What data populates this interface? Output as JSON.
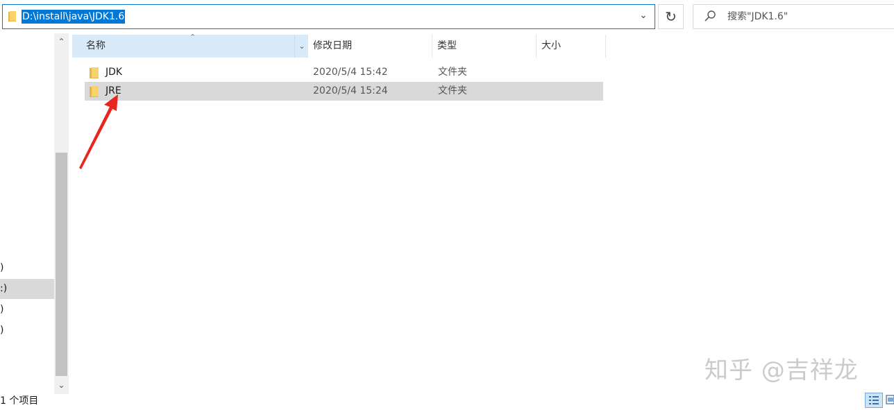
{
  "address_bar": {
    "path": "D:\\install\\java\\JDK1.6",
    "dropdown_icon": "chevron-down-icon",
    "refresh_icon": "refresh-icon"
  },
  "search": {
    "placeholder": "搜索\"JDK1.6\"",
    "icon": "search-icon"
  },
  "columns": {
    "name": "名称",
    "date_modified": "修改日期",
    "type": "类型",
    "size": "大小"
  },
  "files": [
    {
      "name": "JDK",
      "date_modified": "2020/5/4 15:42",
      "type": "文件夹",
      "size": ""
    },
    {
      "name": "JRE",
      "date_modified": "2020/5/4 15:24",
      "type": "文件夹",
      "size": ""
    }
  ],
  "navigation_pane": {
    "items": [
      ")",
      ":)",
      ")",
      ")"
    ],
    "selected_index": 1
  },
  "status_bar": {
    "text": "1 个项目"
  },
  "watermark": "知乎 @吉祥龙",
  "colors": {
    "accent": "#0078d7",
    "selection": "#d9d9d9",
    "header_hover": "#d9ebf9",
    "annotation_arrow": "#e8261f",
    "folder": "#f2c94c"
  }
}
